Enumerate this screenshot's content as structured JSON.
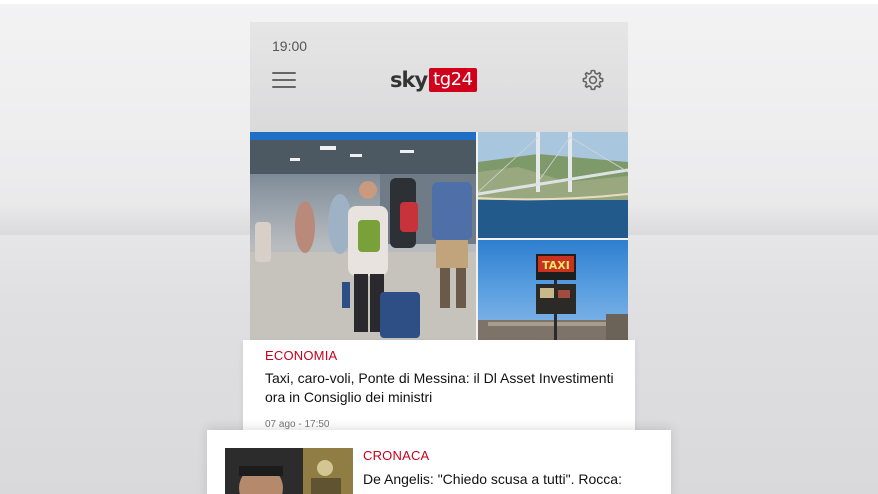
{
  "status_bar": {
    "time": "19:00"
  },
  "header": {
    "menu_icon": "hamburger-icon",
    "logo_sky": "sky",
    "logo_tg": "tg24",
    "settings_icon": "gear-icon",
    "brand_red": "#d0021b"
  },
  "collage": {
    "photos": [
      "airport-travelers-photo",
      "bridge-rendering-photo",
      "taxi-sign-photo"
    ]
  },
  "articles": [
    {
      "category": "ECONOMIA",
      "headline": "Taxi, caro-voli, Ponte di Messina: il Dl Asset Investimenti ora in Consiglio dei ministri",
      "date": "07 ago - 17:50"
    },
    {
      "category": "CRONACA",
      "headline": "De Angelis: \"Chiedo scusa a tutti\". Rocca:"
    }
  ],
  "colors": {
    "category_red": "#c8001b"
  }
}
